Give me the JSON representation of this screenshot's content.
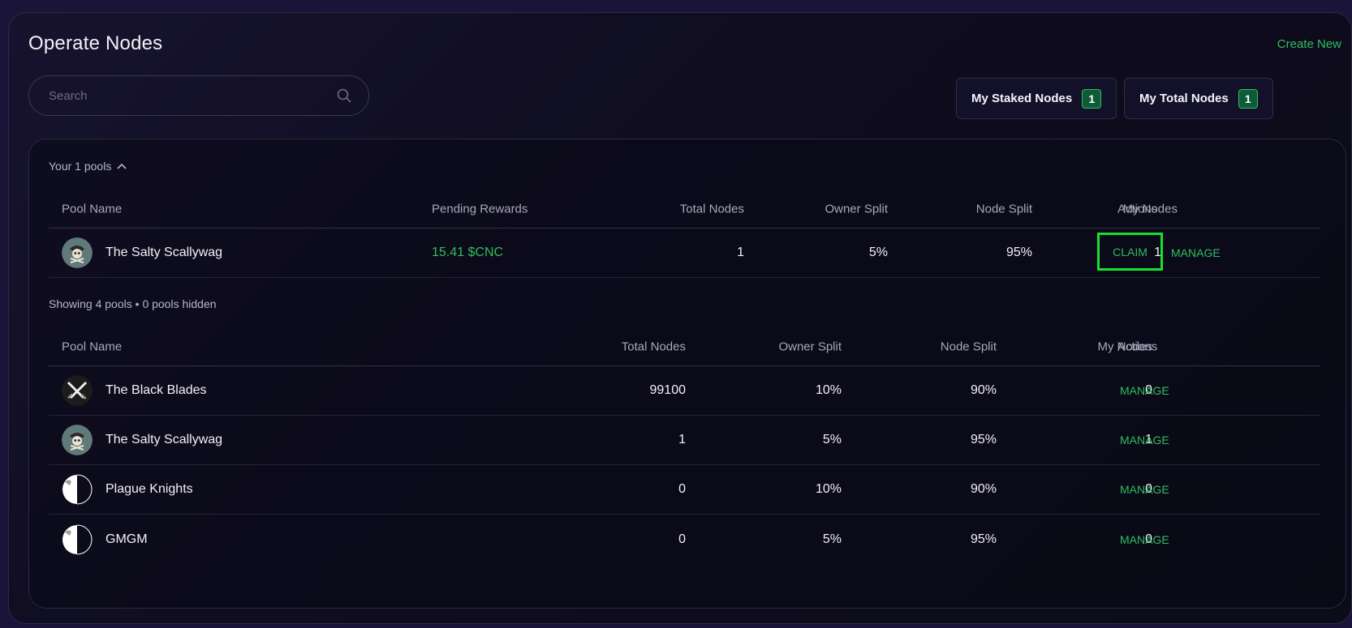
{
  "header": {
    "title": "Operate Nodes",
    "create_new": "Create New"
  },
  "search": {
    "placeholder": "Search",
    "value": ""
  },
  "stats": {
    "staked_label": "My Staked Nodes",
    "staked_count": "1",
    "total_label": "My Total Nodes",
    "total_count": "1"
  },
  "your_pools": {
    "toggle_label": "Your 1 pools",
    "columns": {
      "pool_name": "Pool Name",
      "pending_rewards": "Pending Rewards",
      "total_nodes": "Total Nodes",
      "owner_split": "Owner Split",
      "node_split": "Node Split",
      "my_nodes": "My Nodes",
      "actions": "Actions"
    },
    "rows": [
      {
        "name": "The Salty Scallywag",
        "pending_rewards": "15.41 $CNC",
        "total_nodes": "1",
        "owner_split": "5%",
        "node_split": "95%",
        "my_nodes": "1",
        "claim": "CLAIM",
        "manage": "MANAGE",
        "avatar_icon": "pirate-skull-icon"
      }
    ]
  },
  "all_pools": {
    "summary_showing": "Showing 4 pools",
    "summary_hidden": "0 pools hidden",
    "columns": {
      "pool_name": "Pool Name",
      "total_nodes": "Total Nodes",
      "owner_split": "Owner Split",
      "node_split": "Node Split",
      "my_nodes": "My Nodes",
      "actions": "Actions"
    },
    "rows": [
      {
        "name": "The Black Blades",
        "total_nodes": "99100",
        "owner_split": "10%",
        "node_split": "90%",
        "my_nodes": "0",
        "manage": "MANAGE",
        "avatar_icon": "crossed-swords-icon"
      },
      {
        "name": "The Salty Scallywag",
        "total_nodes": "1",
        "owner_split": "5%",
        "node_split": "95%",
        "my_nodes": "1",
        "manage": "MANAGE",
        "avatar_icon": "pirate-skull-icon"
      },
      {
        "name": "Plague Knights",
        "total_nodes": "0",
        "owner_split": "10%",
        "node_split": "90%",
        "my_nodes": "0",
        "manage": "MANAGE",
        "avatar_icon": "broken-image-icon"
      },
      {
        "name": "GMGM",
        "total_nodes": "0",
        "owner_split": "5%",
        "node_split": "95%",
        "my_nodes": "0",
        "manage": "MANAGE",
        "avatar_icon": "broken-image-icon"
      }
    ]
  },
  "colors": {
    "accent_green": "#2fbf5e",
    "highlight_box": "#17e02d",
    "background": "#0c0b18"
  }
}
